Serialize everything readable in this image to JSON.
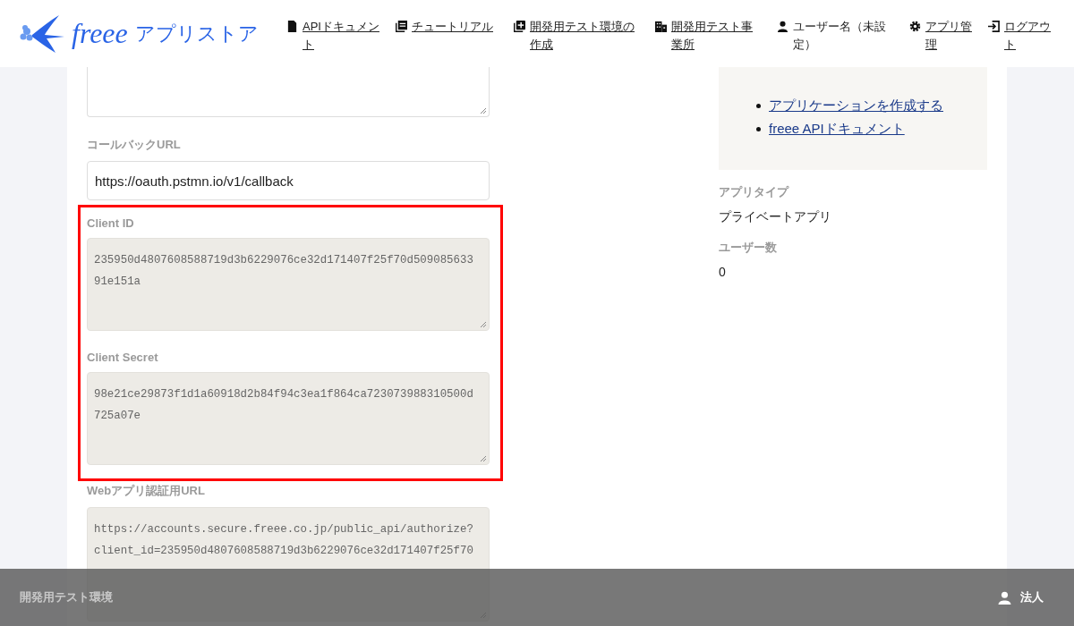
{
  "header": {
    "logo": {
      "brand": "freee",
      "product": "アプリストア"
    },
    "nav": [
      {
        "label": "APIドキュメント",
        "link": true
      },
      {
        "label": "チュートリアル",
        "link": true
      },
      {
        "label": "開発用テスト環境の作成",
        "link": true
      },
      {
        "label": "開発用テスト事業所",
        "link": true
      },
      {
        "label": "ユーザー名（未設定）",
        "link": false
      },
      {
        "label": "アプリ管理",
        "link": true
      },
      {
        "label": "ログアウト",
        "link": true
      }
    ]
  },
  "form": {
    "groups": [
      {
        "highlighted": false,
        "fields": [
          {
            "kind": "textarea",
            "readonly": false
          }
        ]
      },
      {
        "highlighted": false,
        "fields": [
          {
            "kind": "input",
            "label": "コールバックURL",
            "value": "https://oauth.pstmn.io/v1/callback"
          }
        ]
      },
      {
        "highlighted": true,
        "fields": [
          {
            "kind": "textarea",
            "label": "Client ID",
            "value": "235950d4807608588719d3b6229076ce32d171407f25f70d50908563391e151a",
            "readonly": true
          },
          {
            "kind": "textarea",
            "label": "Client Secret",
            "value": "98e21ce29873f1d1a60918d2b84f94c3ea1f864ca723073988310500d725a07e",
            "readonly": true
          }
        ]
      },
      {
        "highlighted": false,
        "fields": [
          {
            "kind": "textarea",
            "label": "Webアプリ認証用URL",
            "value": "https://accounts.secure.freee.co.jp/public_api/authorize?client_id=235950d4807608588719d3b6229076ce32d171407f25f70",
            "readonly": true
          }
        ]
      }
    ]
  },
  "sidebar": {
    "links": [
      "アプリケーションを作成する",
      "freee APIドキュメント"
    ],
    "details": [
      {
        "label": "アプリタイプ",
        "value": "プライベートアプリ"
      },
      {
        "label": "ユーザー数",
        "value": "0"
      }
    ]
  },
  "footer": {
    "environment": "開発用テスト環境",
    "account": "法人"
  }
}
